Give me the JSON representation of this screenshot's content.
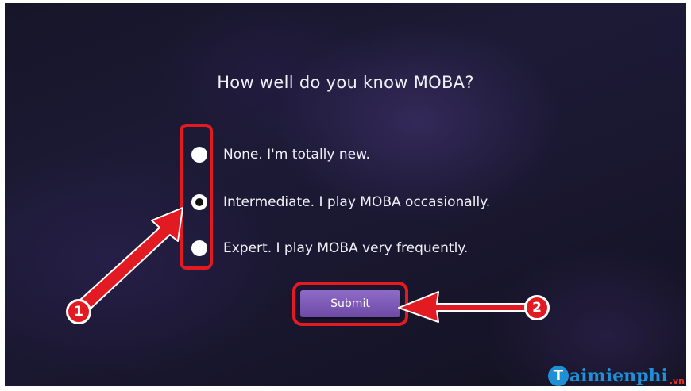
{
  "question": "How well do you know MOBA?",
  "options": [
    {
      "label": "None. I'm totally new.",
      "selected": false
    },
    {
      "label": "Intermediate. I play MOBA occasionally.",
      "selected": true
    },
    {
      "label": "Expert. I play MOBA very frequently.",
      "selected": false
    }
  ],
  "submit_label": "Submit",
  "annotations": {
    "badge_1": "1",
    "badge_2": "2",
    "highlight_color": "#e21b23"
  },
  "watermark": {
    "logo_letter": "T",
    "text": "aimienphi",
    "suffix": ".vn"
  }
}
